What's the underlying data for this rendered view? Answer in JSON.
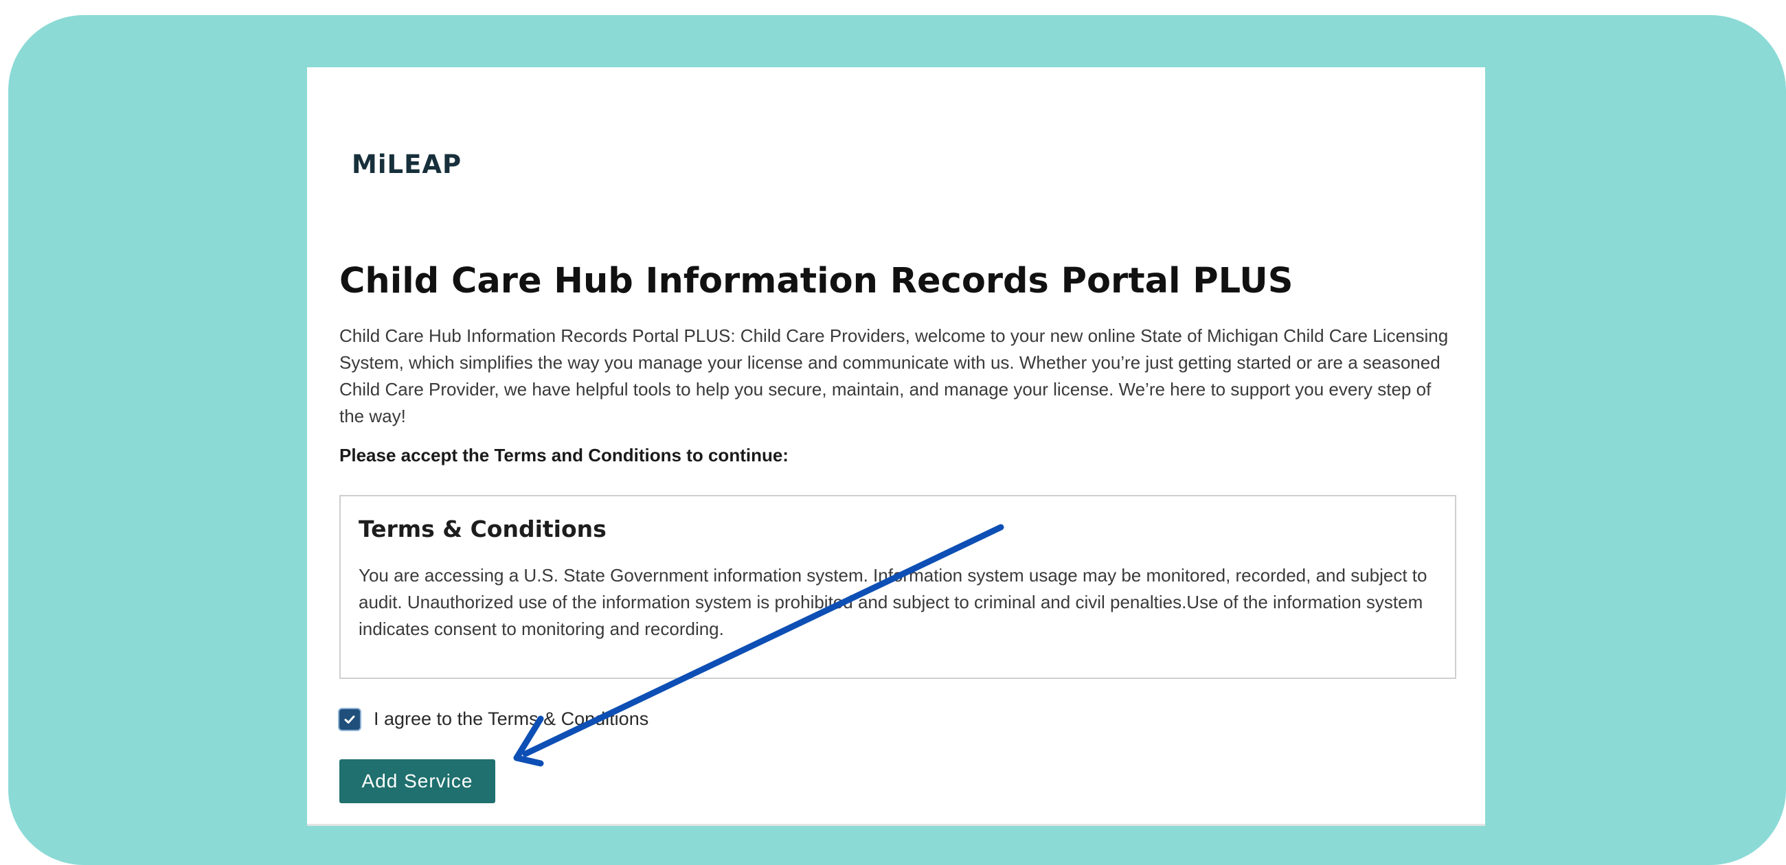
{
  "logo": {
    "text": "MiLEAP"
  },
  "page": {
    "title": "Child Care Hub Information Records Portal PLUS",
    "intro": "Child Care Hub Information Records Portal PLUS: Child Care Providers, welcome to your new online State of Michigan Child Care Licensing System, which simplifies the way you manage your license and communicate with us. Whether you’re just getting started or are a seasoned Child Care Provider, we have helpful tools to help you secure, maintain, and manage your license. We’re here to support you every step of the way!",
    "prompt": "Please accept the Terms and Conditions to continue:"
  },
  "terms": {
    "title": "Terms & Conditions",
    "text": "You are accessing a U.S. State Government information system. Information system usage may be monitored, recorded, and subject to audit. Unauthorized use of the information system is prohibited and subject to criminal and civil penalties.Use of the information system indicates consent to monitoring and recording."
  },
  "agree": {
    "label": "I agree to the Terms & Conditions",
    "checked": true
  },
  "action": {
    "button_label": "Add Service"
  },
  "colors": {
    "frame_background": "#8bdad6",
    "button": "#1f706e",
    "checkbox": "#1f4f7a",
    "annotation_arrow": "#0d4fb5"
  },
  "icons": {
    "checkbox": "check-icon",
    "annotation": "arrow-annotation-icon"
  }
}
